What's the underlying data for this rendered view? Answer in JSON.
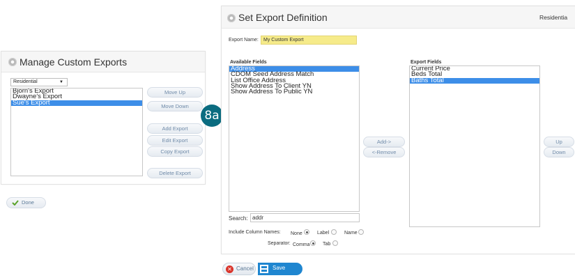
{
  "badge": "8a",
  "manage": {
    "title": "Manage Custom Exports",
    "dropdown_value": "Residential",
    "dropdown_arrow": "▼",
    "exports": [
      {
        "label": "Bjorn's Export",
        "selected": false
      },
      {
        "label": "Dwayne's Export",
        "selected": false
      },
      {
        "label": "Sue's Export",
        "selected": true
      }
    ],
    "buttons": {
      "move_up": "Move Up",
      "move_down": "Move Down",
      "add": "Add Export",
      "edit": "Edit Export",
      "copy": "Copy Export",
      "delete": "Delete Export"
    },
    "done_label": "Done"
  },
  "definition": {
    "title": "Set Export Definition",
    "property_type": "Residentia",
    "export_name_label": "Export Name:",
    "export_name_value": "My Custom Export",
    "available_header": "Available Fields",
    "available_fields": [
      {
        "label": "Address",
        "selected": true
      },
      {
        "label": "CDOM Seed Address Match",
        "selected": false
      },
      {
        "label": "List Office Address",
        "selected": false
      },
      {
        "label": "Show Address To Client YN",
        "selected": false
      },
      {
        "label": "Show Address To Public YN",
        "selected": false
      }
    ],
    "export_header": "Export Fields",
    "export_fields": [
      {
        "label": "Current Price",
        "selected": false
      },
      {
        "label": "Beds Total",
        "selected": false
      },
      {
        "label": "Baths Total",
        "selected": true
      }
    ],
    "add_label": "Add->",
    "remove_label": "<-Remove",
    "up_label": "Up",
    "down_label": "Down",
    "search_label": "Search:",
    "search_value": "addr",
    "include_label": "Include Column Names:",
    "include_options": {
      "none": "None",
      "label": "Label",
      "name": "Name"
    },
    "include_selected": "None",
    "separator_label": "Separator:",
    "separator_options": {
      "comma": "Comma",
      "tab": "Tab"
    },
    "separator_selected": "Comma",
    "cancel_label": "Cancel",
    "save_label": "Save"
  },
  "colors": {
    "selection": "#3d8ee8",
    "badge": "#0b6c80",
    "save": "#1f86d0",
    "cancel_icon": "#d9342b",
    "done_check": "#5aa32b",
    "export_name_bg": "#f6eb8a"
  }
}
